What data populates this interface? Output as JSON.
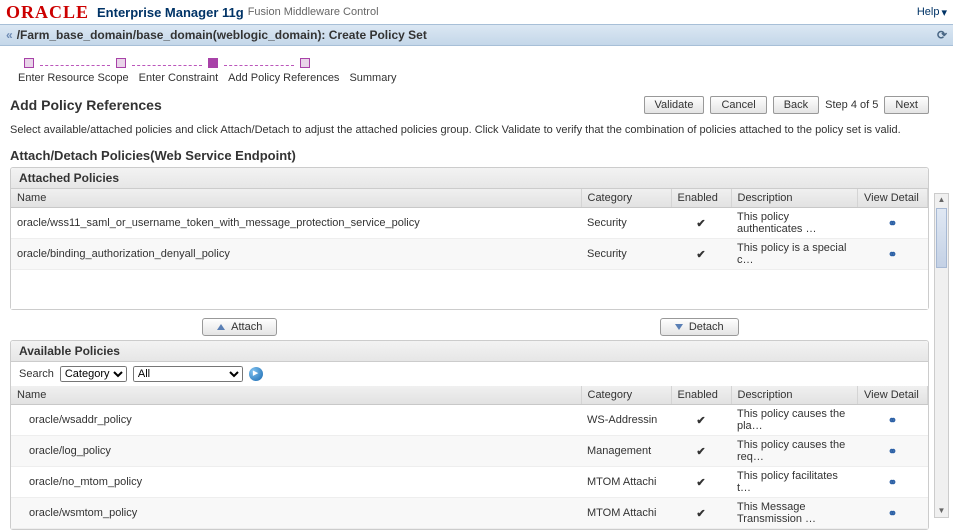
{
  "header": {
    "logo": "ORACLE",
    "product": "Enterprise Manager 11g",
    "subproduct": "Fusion Middleware Control",
    "help": "Help"
  },
  "breadcrumb": {
    "path": "/Farm_base_domain/base_domain(weblogic_domain): Create Policy Set"
  },
  "wizard": {
    "steps": [
      {
        "label": "Enter Resource Scope"
      },
      {
        "label": "Enter Constraint"
      },
      {
        "label": "Add Policy References",
        "current": true
      },
      {
        "label": "Summary"
      }
    ]
  },
  "page": {
    "title": "Add Policy References",
    "validate_btn": "Validate",
    "cancel_btn": "Cancel",
    "back_btn": "Back",
    "step_text": "Step 4 of 5",
    "next_btn": "Next",
    "instruction": "Select available/attached policies and click Attach/Detach to adjust the attached policies group. Click Validate to verify that the combination of policies attached to the policy set is valid."
  },
  "section_title": "Attach/Detach Policies(Web Service Endpoint)",
  "attached": {
    "panel_title": "Attached Policies",
    "columns": {
      "name": "Name",
      "category": "Category",
      "enabled": "Enabled",
      "description": "Description",
      "detail": "View Detail"
    },
    "rows": [
      {
        "name": "oracle/wss11_saml_or_username_token_with_message_protection_service_policy",
        "category": "Security",
        "description": "This policy authenticates …"
      },
      {
        "name": "oracle/binding_authorization_denyall_policy",
        "category": "Security",
        "description": "This policy is a special c…"
      }
    ]
  },
  "attach_btn": "Attach",
  "detach_btn": "Detach",
  "available": {
    "panel_title": "Available Policies",
    "search_label": "Search",
    "search_field_options": [
      "Category"
    ],
    "search_value_options": [
      "All"
    ],
    "columns": {
      "name": "Name",
      "category": "Category",
      "enabled": "Enabled",
      "description": "Description",
      "detail": "View Detail"
    },
    "rows": [
      {
        "name": "oracle/wsaddr_policy",
        "category": "WS-Addressin",
        "description": "This policy causes the pla…"
      },
      {
        "name": "oracle/log_policy",
        "category": "Management",
        "description": "This policy causes the req…"
      },
      {
        "name": "oracle/no_mtom_policy",
        "category": "MTOM Attachi",
        "description": "This policy facilitates t…"
      },
      {
        "name": "oracle/wsmtom_policy",
        "category": "MTOM Attachi",
        "description": "This Message Transmission …"
      }
    ]
  }
}
